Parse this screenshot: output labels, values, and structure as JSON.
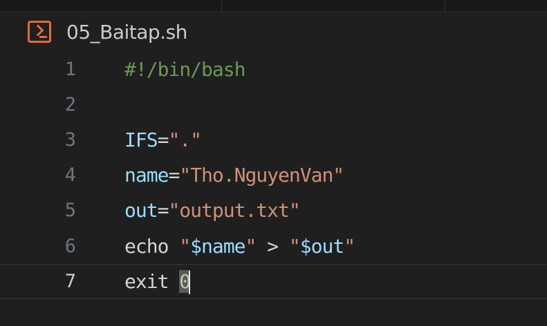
{
  "editor": {
    "file_name": "05_Baitap.sh",
    "file_icon": "terminal-icon",
    "lines": [
      {
        "number": "1",
        "parts": [
          {
            "t": "comment",
            "v": "#!/bin/bash"
          }
        ]
      },
      {
        "number": "2",
        "parts": []
      },
      {
        "number": "3",
        "parts": [
          {
            "t": "var",
            "v": "IFS"
          },
          {
            "t": "op",
            "v": "="
          },
          {
            "t": "str",
            "v": "\".\""
          }
        ]
      },
      {
        "number": "4",
        "parts": [
          {
            "t": "var",
            "v": "name"
          },
          {
            "t": "op",
            "v": "="
          },
          {
            "t": "str",
            "v": "\"Tho.NguyenVan\""
          }
        ]
      },
      {
        "number": "5",
        "parts": [
          {
            "t": "var",
            "v": "out"
          },
          {
            "t": "op",
            "v": "="
          },
          {
            "t": "str",
            "v": "\"output.txt\""
          }
        ]
      },
      {
        "number": "6",
        "parts": [
          {
            "t": "cmd",
            "v": "echo "
          },
          {
            "t": "str",
            "v": "\""
          },
          {
            "t": "expand",
            "v": "$name"
          },
          {
            "t": "str",
            "v": "\""
          },
          {
            "t": "op",
            "v": " > "
          },
          {
            "t": "str",
            "v": "\""
          },
          {
            "t": "expand",
            "v": "$out"
          },
          {
            "t": "str",
            "v": "\""
          }
        ]
      },
      {
        "number": "7",
        "parts": [
          {
            "t": "cmd",
            "v": "exit "
          },
          {
            "t": "num-cursor",
            "v": "0"
          }
        ]
      }
    ],
    "current_line": "7",
    "colors": {
      "background": "#1f1f1f",
      "line_number": "#6e7681",
      "comment": "#6a9955",
      "variable": "#9cdcfe",
      "string": "#ce9178",
      "number": "#b5cea8",
      "icon": "#e8693d"
    }
  }
}
